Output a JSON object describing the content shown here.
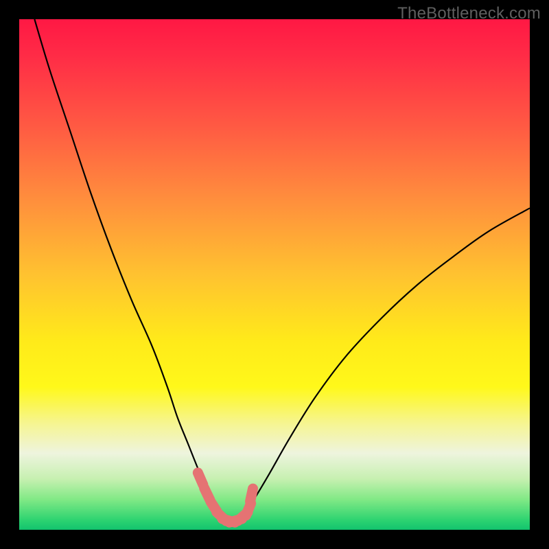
{
  "watermark": "TheBottleneck.com",
  "colors": {
    "frame": "#000000",
    "curve_stroke": "#000000",
    "marker_fill": "#e57373",
    "marker_stroke": "#e57373",
    "watermark_text": "#5f5f5f"
  },
  "chart_data": {
    "type": "line",
    "title": "",
    "xlabel": "",
    "ylabel": "",
    "xlim": [
      0,
      100
    ],
    "ylim": [
      0,
      100
    ],
    "grid": false,
    "legend": false,
    "x": [
      3,
      6,
      10,
      14,
      18,
      22,
      26,
      29,
      31,
      33,
      35,
      36.5,
      38,
      39,
      40,
      41,
      42,
      43,
      44,
      46,
      49,
      53,
      58,
      64,
      71,
      78,
      85,
      92,
      100
    ],
    "y": [
      100,
      90,
      78,
      66,
      55,
      45,
      36,
      28,
      22,
      17,
      12,
      8.5,
      5.5,
      3.5,
      2.2,
      1.8,
      1.8,
      2.2,
      3.2,
      6,
      11,
      18,
      26,
      34,
      41.5,
      48,
      53.5,
      58.5,
      63
    ],
    "markers": {
      "x": [
        35.5,
        36.8,
        38.2,
        39.6,
        41.0,
        42.4,
        43.8,
        44.9,
        45.5
      ],
      "y": [
        10.0,
        7.0,
        4.4,
        2.6,
        1.8,
        1.8,
        2.6,
        4.0,
        6.8
      ]
    }
  }
}
